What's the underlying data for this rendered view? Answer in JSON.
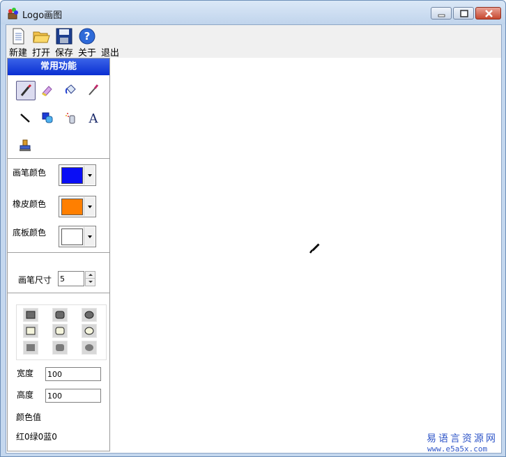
{
  "window": {
    "title": "Logo画图"
  },
  "toolbar": {
    "new_label": "新建",
    "open_label": "打开",
    "save_label": "保存",
    "about_label": "关于",
    "exit_label": "退出"
  },
  "panel": {
    "header": "常用功能",
    "tools": [
      "brush-icon",
      "eraser-icon",
      "paint-bucket-icon",
      "eyedropper-icon",
      "line-icon",
      "shape-icon",
      "spray-icon",
      "text-icon",
      "stamp-icon"
    ],
    "pen_color_label": "画笔颜色",
    "pen_color": "#0a0ef5",
    "eraser_color_label": "橡皮颜色",
    "eraser_color": "#ff7f00",
    "bg_color_label": "底板颜色",
    "bg_color": "#ffffff",
    "pen_size_label": "画笔尺寸",
    "pen_size": "5",
    "width_label": "宽度",
    "width_value": "100",
    "height_label": "高度",
    "height_value": "100",
    "color_value_label": "颜色值",
    "color_value_text": "红0绿0蓝0"
  },
  "canvas": {
    "watermark_cn": "易语言资源网",
    "watermark_url": "www.e5a5x.com"
  }
}
